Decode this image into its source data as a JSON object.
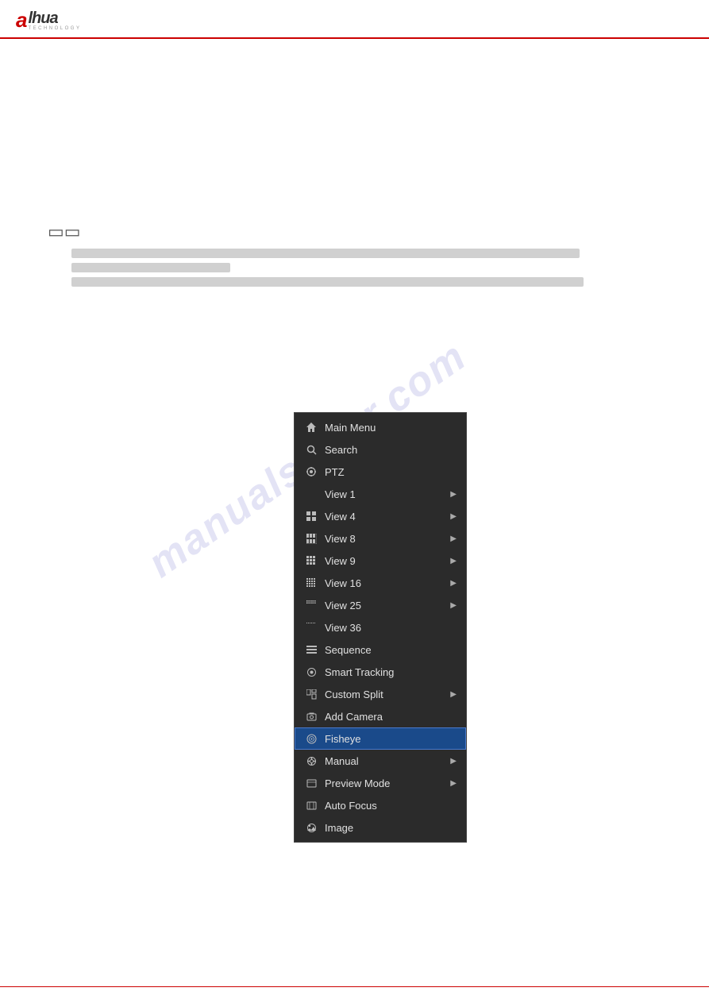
{
  "header": {
    "logo_letter": "a",
    "logo_name": "lhua",
    "logo_subtext": "TECHNOLOGY"
  },
  "note_icon": "□□",
  "text_bars": [
    {
      "width": "full"
    },
    {
      "width": "medium"
    },
    {
      "width": "full2"
    }
  ],
  "context_menu": {
    "items": [
      {
        "id": "main-menu",
        "label": "Main Menu",
        "icon": "⌂",
        "has_arrow": false,
        "highlighted": false
      },
      {
        "id": "search",
        "label": "Search",
        "icon": "🔍",
        "has_arrow": false,
        "highlighted": false
      },
      {
        "id": "ptz",
        "label": "PTZ",
        "icon": "◎",
        "has_arrow": false,
        "highlighted": false
      },
      {
        "id": "view1",
        "label": "View 1",
        "icon": "▪",
        "has_arrow": true,
        "highlighted": false
      },
      {
        "id": "view4",
        "label": "View 4",
        "icon": "⊞",
        "has_arrow": true,
        "highlighted": false
      },
      {
        "id": "view8",
        "label": "View 8",
        "icon": "⊟",
        "has_arrow": true,
        "highlighted": false
      },
      {
        "id": "view9",
        "label": "View 9",
        "icon": "⊞",
        "has_arrow": true,
        "highlighted": false
      },
      {
        "id": "view16",
        "label": "View 16",
        "icon": "⊞",
        "has_arrow": true,
        "highlighted": false
      },
      {
        "id": "view25",
        "label": "View 25",
        "icon": "⊞",
        "has_arrow": true,
        "highlighted": false
      },
      {
        "id": "view36",
        "label": "View 36",
        "icon": "⊞",
        "has_arrow": false,
        "highlighted": false
      },
      {
        "id": "sequence",
        "label": "Sequence",
        "icon": "≡",
        "has_arrow": false,
        "highlighted": false
      },
      {
        "id": "smart-tracking",
        "label": "Smart Tracking",
        "icon": "◎",
        "has_arrow": false,
        "highlighted": false
      },
      {
        "id": "custom-split",
        "label": "Custom Split",
        "icon": "⊟",
        "has_arrow": true,
        "highlighted": false
      },
      {
        "id": "add-camera",
        "label": "Add Camera",
        "icon": "⊞",
        "has_arrow": false,
        "highlighted": false
      },
      {
        "id": "fisheye",
        "label": "Fisheye",
        "icon": "◎",
        "has_arrow": false,
        "highlighted": true
      },
      {
        "id": "manual",
        "label": "Manual",
        "icon": "⚙",
        "has_arrow": true,
        "highlighted": false
      },
      {
        "id": "preview-mode",
        "label": "Preview Mode",
        "icon": "□",
        "has_arrow": true,
        "highlighted": false
      },
      {
        "id": "auto-focus",
        "label": "Auto Focus",
        "icon": "□",
        "has_arrow": false,
        "highlighted": false
      },
      {
        "id": "image",
        "label": "Image",
        "icon": "◎",
        "has_arrow": false,
        "highlighted": false
      }
    ]
  },
  "watermark": "manualsriver.com"
}
